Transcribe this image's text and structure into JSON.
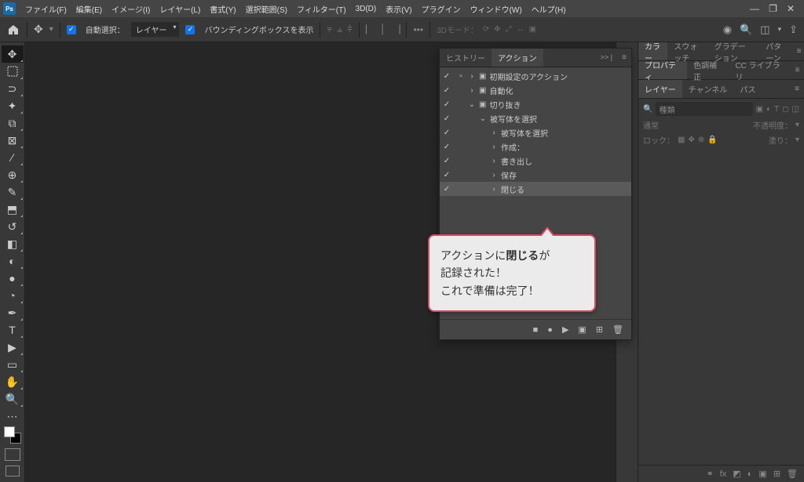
{
  "menubar": {
    "items": [
      "ファイル(F)",
      "編集(E)",
      "イメージ(I)",
      "レイヤー(L)",
      "書式(Y)",
      "選択範囲(S)",
      "フィルター(T)",
      "3D(D)",
      "表示(V)",
      "プラグイン",
      "ウィンドウ(W)",
      "ヘルプ(H)"
    ]
  },
  "window_controls": {
    "minimize": "—",
    "restore": "❐",
    "close": "✕"
  },
  "options_bar": {
    "auto_select_label": "自動選択：",
    "auto_select_target": "レイヤー",
    "show_bbox_label": "バウンディングボックスを表示",
    "mode_label": "3Dモード："
  },
  "actions_panel": {
    "tabs": {
      "history": "ヒストリー",
      "actions": "アクション"
    },
    "collapse": ">> |",
    "rows": [
      {
        "chk": true,
        "toggle": true,
        "indent": 0,
        "expand": ">",
        "icon": "folder",
        "label": "初期設定のアクション"
      },
      {
        "chk": true,
        "toggle": false,
        "indent": 0,
        "expand": ">",
        "icon": "folder",
        "label": "自動化"
      },
      {
        "chk": true,
        "toggle": false,
        "indent": 0,
        "expand": "v",
        "icon": "folder",
        "label": "切り抜き"
      },
      {
        "chk": true,
        "toggle": false,
        "indent": 1,
        "expand": "v",
        "icon": "",
        "label": "被写体を選択"
      },
      {
        "chk": true,
        "toggle": false,
        "indent": 2,
        "expand": ">",
        "icon": "",
        "label": "被写体を選択"
      },
      {
        "chk": true,
        "toggle": false,
        "indent": 2,
        "expand": ">",
        "icon": "",
        "label": "作成："
      },
      {
        "chk": true,
        "toggle": false,
        "indent": 2,
        "expand": ">",
        "icon": "",
        "label": "書き出し"
      },
      {
        "chk": true,
        "toggle": false,
        "indent": 2,
        "expand": ">",
        "icon": "",
        "label": "保存"
      },
      {
        "chk": true,
        "toggle": false,
        "indent": 2,
        "expand": ">",
        "icon": "",
        "label": "閉じる",
        "selected": true
      }
    ],
    "footer_icons": [
      "stop",
      "record",
      "play",
      "new-set",
      "new-action",
      "trash"
    ]
  },
  "right_panel": {
    "row1": {
      "color": "カラー",
      "swatches": "スウォッチ",
      "gradient": "グラデーション",
      "pattern": "パターン"
    },
    "row2": {
      "properties": "プロパティ",
      "adjust": "色調補正",
      "cclib": "CC ライブラリ"
    },
    "row3": {
      "layers": "レイヤー",
      "channels": "チャンネル",
      "paths": "パス"
    },
    "layers": {
      "search_placeholder": "種類",
      "blend": "通常",
      "opacity_label": "不透明度：",
      "lock_label": "ロック：",
      "fill_label": "塗り："
    }
  },
  "callout": {
    "line1_pre": "アクションに",
    "line1_bold": "閉じる",
    "line1_post": "が",
    "line2": "記録された！",
    "line3": "これで準備は完了！"
  }
}
